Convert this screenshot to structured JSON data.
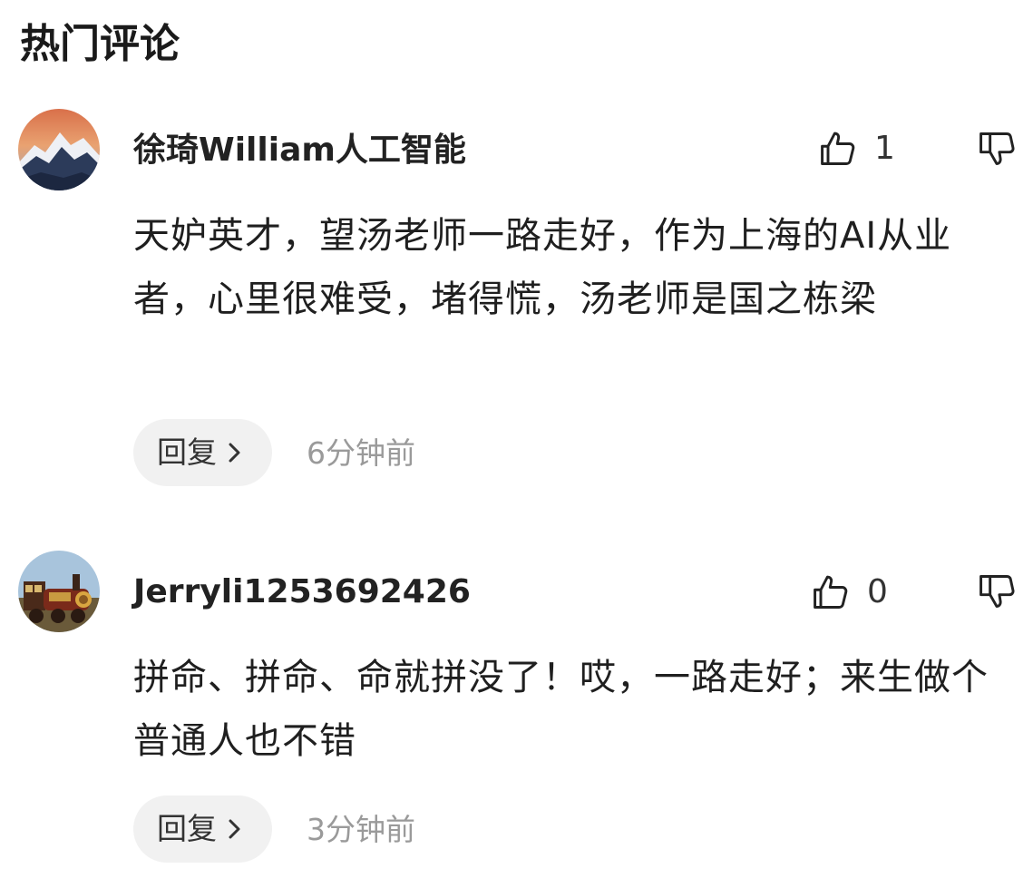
{
  "section_title": "热门评论",
  "comments": [
    {
      "username": "徐琦William人工智能",
      "avatar": "snowy-mountain-sunset-avatar",
      "like_icon": "thumbs-up-icon",
      "like_count": "1",
      "dislike_icon": "thumbs-down-icon",
      "text": "天妒英才，望汤老师一路走好，作为上海的AI从业者，心里很难受，堵得慌，汤老师是国之栋梁",
      "reply_label": "回复",
      "reply_icon": "chevron-right-icon",
      "time": "6分钟前"
    },
    {
      "username": "Jerryli1253692426",
      "avatar": "steam-train-avatar",
      "like_icon": "thumbs-up-icon",
      "like_count": "0",
      "dislike_icon": "thumbs-down-icon",
      "text": "拼命、拼命、命就拼没了！哎，一路走好；来生做个普通人也不错",
      "reply_label": "回复",
      "reply_icon": "chevron-right-icon",
      "time": "3分钟前"
    }
  ]
}
